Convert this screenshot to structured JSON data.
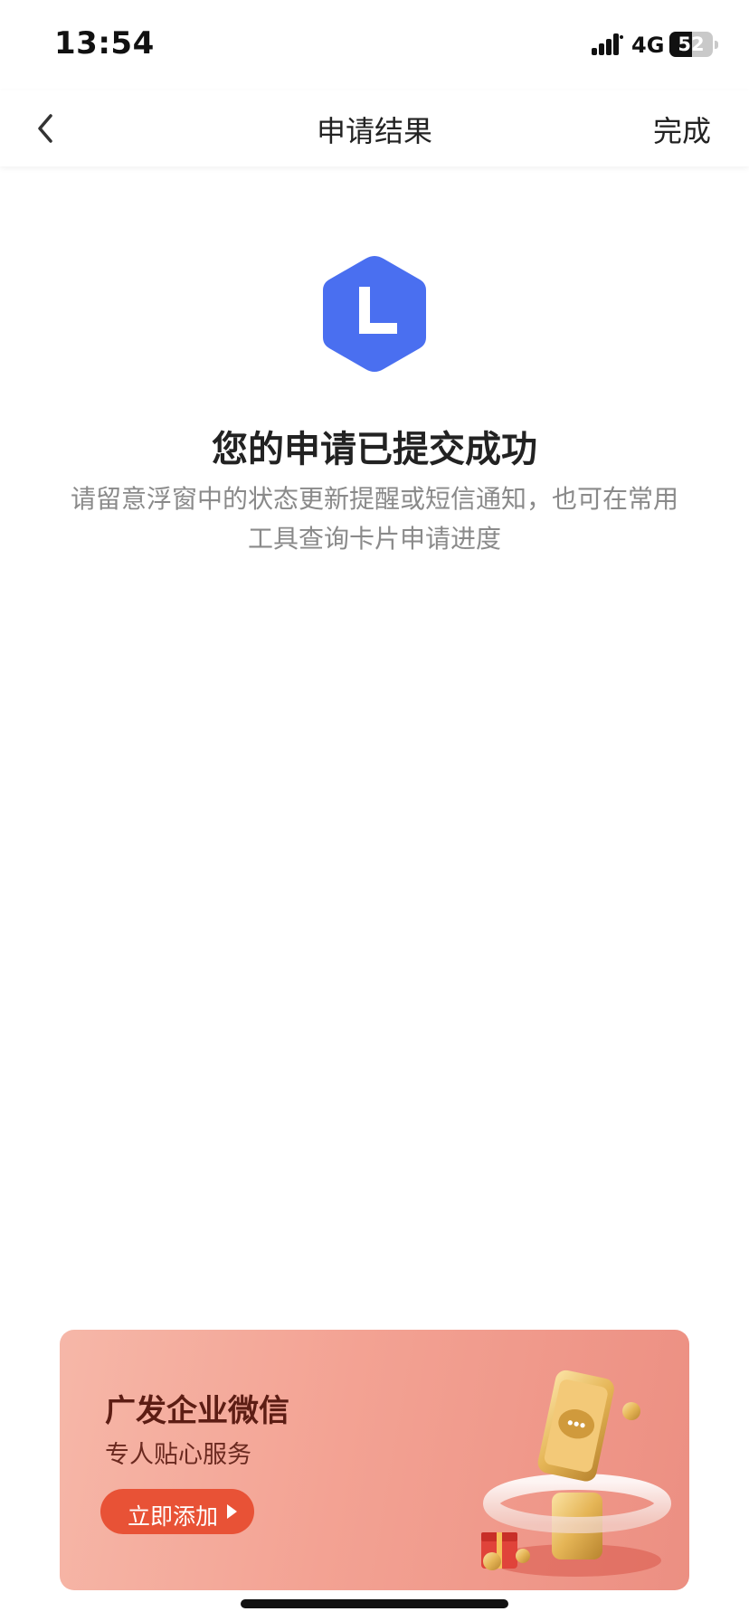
{
  "status_bar": {
    "time": "13:54",
    "network": "4G",
    "battery": "52",
    "battery_level": 0.52
  },
  "nav": {
    "title": "申请结果",
    "done_label": "完成"
  },
  "result": {
    "title": "您的申请已提交成功",
    "description": "请留意浮窗中的状态更新提醒或短信通知，也可在常用工具查询卡片申请进度"
  },
  "promo": {
    "title": "广发企业微信",
    "subtitle": "专人贴心服务",
    "button_label": "立即添加"
  },
  "colors": {
    "accent_blue": "#4a6ff0",
    "promo_button": "#e85236",
    "promo_title": "#5c1d14"
  },
  "icons": {
    "back": "chevron-left-icon",
    "result": "hexagon-clock-icon",
    "button": "play-icon"
  }
}
